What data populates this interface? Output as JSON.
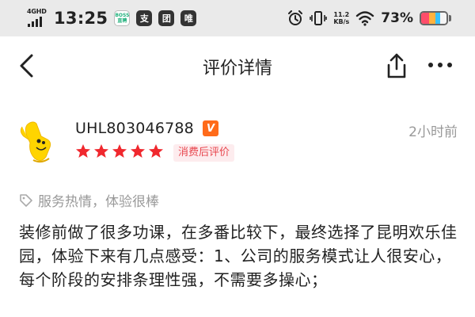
{
  "status_bar": {
    "network": "4GHD",
    "time": "13:25",
    "app_icons": [
      {
        "name": "boss-zhipin-icon",
        "label": "BOSS直聘"
      },
      {
        "name": "alipay-icon",
        "label": "支"
      },
      {
        "name": "meituan-icon",
        "label": "团"
      },
      {
        "name": "vipshop-icon",
        "label": "唯"
      }
    ],
    "speed_value": "11.2",
    "speed_unit": "KB/s",
    "battery_percent": "73%",
    "battery_level": 0.73,
    "icons": [
      "alarm-icon",
      "vibrate-icon",
      "wifi-icon",
      "battery-icon"
    ]
  },
  "nav": {
    "title": "评价详情",
    "icons": [
      "back-arrow-icon",
      "share-icon",
      "more-icon"
    ]
  },
  "review": {
    "username": "UHL803046788",
    "level_badge": "V",
    "time_ago": "2小时前",
    "rating": 5,
    "rating_max": 5,
    "star_color": "#f0282e",
    "consume_badge": "消费后评价",
    "tag": "服务热情，体验很棒",
    "body": "装修前做了很多功课，在多番比较下，最终选择了昆明欢乐佳园，体验下来有几点感受：1、公司的服务模式让人很安心，每个阶段的安排条理性强，不需要多操心；"
  },
  "colors": {
    "accent": "#ff6b1a",
    "badge_bg": "#fdecee",
    "badge_text": "#e8474f",
    "muted": "#999999",
    "status_bg": "#eaeaea"
  }
}
